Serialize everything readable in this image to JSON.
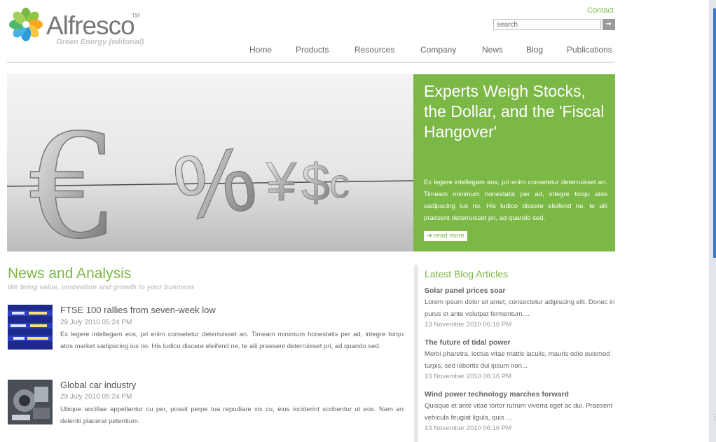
{
  "header": {
    "logo_text": "Alfresco",
    "logo_tm": "TM",
    "tagline": "Green Energy (editorial)",
    "contact_label": "Contact",
    "search_value": "search",
    "search_button_glyph": "➔"
  },
  "nav": {
    "items": [
      "Home",
      "Products",
      "Resources",
      "Company",
      "News",
      "Blog",
      "Publications"
    ]
  },
  "hero": {
    "title": "Experts Weigh Stocks, the Dollar, and the 'Fiscal Hangover'",
    "text": "Ex legere intellegam eos, pri enim consetetur deterruisset an. Timeam minimum honestatis per ad, integre torqu atos sadipscing ius no. His ludico discere eleifend ne, te alii praesent deterruisset pri, ad quando sed.",
    "read_more": "➔ read more",
    "image_symbols": [
      "€",
      "%",
      "¥",
      "$",
      "c"
    ]
  },
  "news": {
    "title": "News and Analysis",
    "subtitle": "We bring value, innovation and growth to your business",
    "articles": [
      {
        "title": "FTSE 100 rallies from seven-week low",
        "date": "29 July 2010 05:24 PM",
        "text": "Ex legere intellegam eos, pri enim consetetur deterruisset an. Timeam minimum honestatis per ad, integre torqu atos market sadipscing ius no. His ludico discere eleifend ne, te alii praesent deterruisset pri, ad quando sed."
      },
      {
        "title": "Global car industry",
        "date": "29 July 2010 05:24 PM",
        "text": "Ubique ancillae appellantur cu per, possit perpe tua repudiare vix cu, eius inciderint scribentur ut eos. Nam an deleniti placerat petentium."
      }
    ]
  },
  "blog": {
    "title": "Latest Blog Articles",
    "posts": [
      {
        "title": "Solar panel prices soar",
        "text": "Lorem ipsum dolor sit amet, consectetur adipiscing elit. Donec in purus et ante volutpat fermentum....",
        "date": "13 November 2010 06:16 PM"
      },
      {
        "title": "The future of tidal power",
        "text": "Morbi pharetra, lectus vitae mattis iaculis, mauris odio euismod turpis, sed lobortis dui ipsum non...",
        "date": "13 November 2010 06:16 PM"
      },
      {
        "title": "Wind power technology marches forward",
        "text": "Quisque et ante vitae tortor rutrum viverra eget ac dui. Praesent vehicula feugiat ligula, quis ...",
        "date": "13 November 2010 06:16 PM"
      }
    ]
  },
  "colors": {
    "accent_green": "#7cb845",
    "text_gray": "#666666",
    "date_gray": "#999999"
  }
}
